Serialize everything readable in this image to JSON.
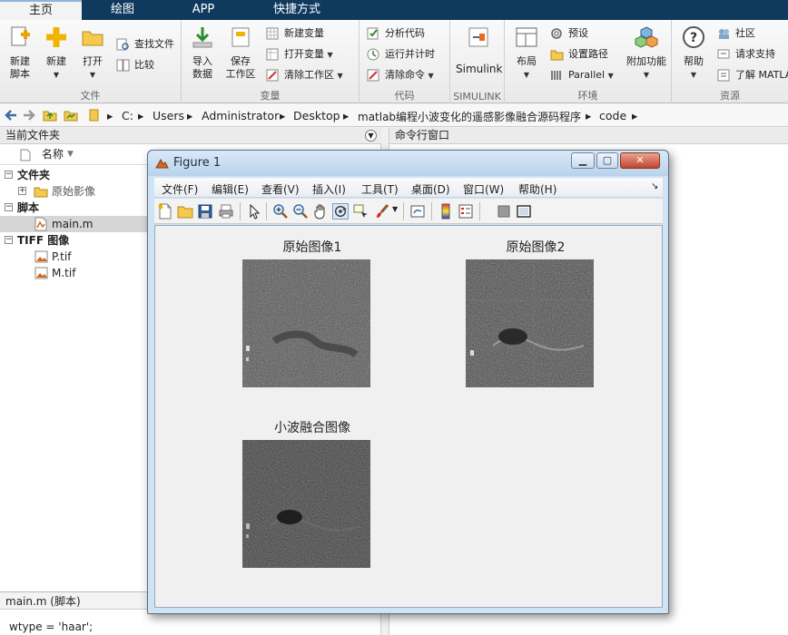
{
  "tabs": [
    "主页",
    "绘图",
    "APP",
    "快捷方式"
  ],
  "ribbon": {
    "file": {
      "label": "文件",
      "new_script": "新建\n脚本",
      "new": "新建",
      "open": "打开",
      "find_files": "查找文件",
      "compare": "比较"
    },
    "variable": {
      "label": "变量",
      "import": "导入\n数据",
      "save_ws": "保存\n工作区",
      "new_var": "新建变量",
      "open_var": "打开变量",
      "clear_ws": "清除工作区"
    },
    "code": {
      "label": "代码",
      "analyze": "分析代码",
      "run_time": "运行并计时",
      "clear_cmd": "清除命令"
    },
    "simulink": {
      "label": "SIMULINK",
      "btn": "Simulink"
    },
    "env": {
      "label": "环境",
      "layout": "布局",
      "prefs": "预设",
      "set_path": "设置路径",
      "parallel": "Parallel",
      "addons": "附加功能"
    },
    "resources": {
      "label": "资源",
      "help": "帮助",
      "community": "社区",
      "support": "请求支持",
      "learn": "了解 MATLAB"
    }
  },
  "address": [
    "C:",
    "Users",
    "Administrator",
    "Desktop",
    "matlab编程小波变化的遥感影像融合源码程序",
    "code"
  ],
  "left_panel": {
    "title": "当前文件夹",
    "col_name": "名称",
    "groups": [
      {
        "name": "文件夹",
        "items": [
          "原始影像"
        ]
      },
      {
        "name": "脚本",
        "items": [
          "main.m"
        ]
      },
      {
        "name": "TIFF 图像",
        "items": [
          "P.tif",
          "M.tif"
        ]
      }
    ],
    "details": "main.m  (脚本)",
    "code_line": "wtype = 'haar';"
  },
  "command_window": {
    "title": "命令行窗口"
  },
  "figure": {
    "title": "Figure 1",
    "menus": [
      "文件(F)",
      "编辑(E)",
      "查看(V)",
      "插入(I)",
      "工具(T)",
      "桌面(D)",
      "窗口(W)",
      "帮助(H)"
    ],
    "axes_titles": [
      "原始图像1",
      "原始图像2",
      "小波融合图像"
    ]
  }
}
